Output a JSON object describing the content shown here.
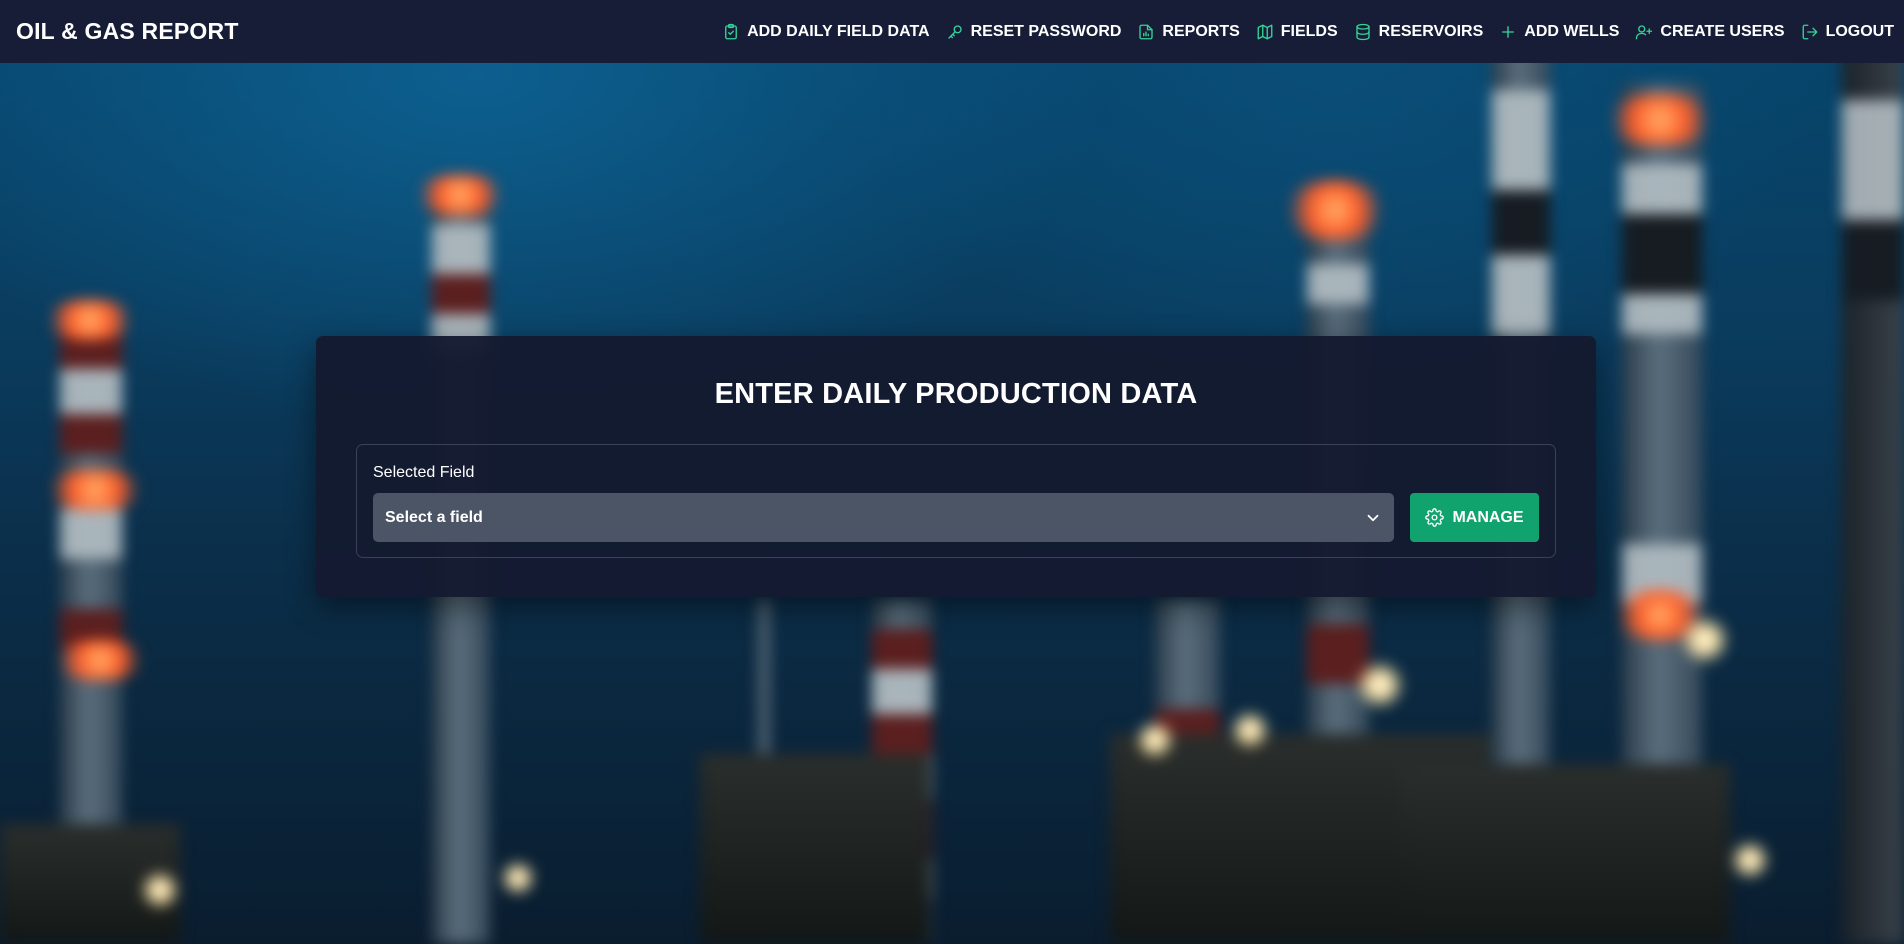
{
  "app": {
    "title": "OIL & GAS REPORT"
  },
  "nav": {
    "items": [
      {
        "label": "ADD DAILY FIELD DATA",
        "icon": "clipboard-check-icon"
      },
      {
        "label": "RESET PASSWORD",
        "icon": "key-icon"
      },
      {
        "label": "REPORTS",
        "icon": "file-chart-icon"
      },
      {
        "label": "FIELDS",
        "icon": "map-icon"
      },
      {
        "label": "RESERVOIRS",
        "icon": "database-icon"
      },
      {
        "label": "ADD WELLS",
        "icon": "plus-icon"
      },
      {
        "label": "CREATE USERS",
        "icon": "user-plus-icon"
      },
      {
        "label": "LOGOUT",
        "icon": "logout-icon"
      }
    ]
  },
  "main": {
    "title": "ENTER DAILY PRODUCTION DATA",
    "field_label": "Selected Field",
    "field_select_value": "Select a field",
    "manage_label": "MANAGE"
  },
  "colors": {
    "topbar": "#171d36",
    "card": "#141a30",
    "accent_green": "#10a36e",
    "icon_green": "#34d399",
    "select_bg": "#4b5565"
  }
}
